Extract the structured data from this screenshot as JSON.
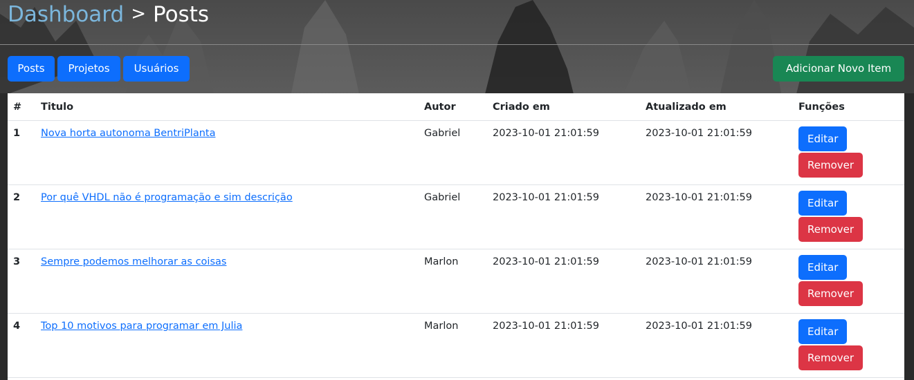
{
  "header": {
    "breadcrumb_root": "Dashboard",
    "breadcrumb_separator": ">",
    "breadcrumb_current": "Posts"
  },
  "nav": {
    "posts": "Posts",
    "projetos": "Projetos",
    "usuarios": "Usuários"
  },
  "actions": {
    "add_new": "Adicionar Novo Item"
  },
  "table": {
    "columns": [
      "#",
      "Titulo",
      "Autor",
      "Criado em",
      "Atualizado em",
      "Funções"
    ],
    "rows": [
      {
        "id": "1",
        "title": "Nova horta autonoma BentriPlanta",
        "author": "Gabriel",
        "created": "2023-10-01 21:01:59",
        "updated": "2023-10-01 21:01:59"
      },
      {
        "id": "2",
        "title": "Por quê VHDL não é programação e sim descrição",
        "author": "Gabriel",
        "created": "2023-10-01 21:01:59",
        "updated": "2023-10-01 21:01:59"
      },
      {
        "id": "3",
        "title": "Sempre podemos melhorar as coisas",
        "author": "Marlon",
        "created": "2023-10-01 21:01:59",
        "updated": "2023-10-01 21:01:59"
      },
      {
        "id": "4",
        "title": "Top 10 motivos para programar em Julia",
        "author": "Marlon",
        "created": "2023-10-01 21:01:59",
        "updated": "2023-10-01 21:01:59"
      }
    ],
    "edit_label": "Editar",
    "remove_label": "Remover"
  },
  "colors": {
    "primary": "#0d6efd",
    "success": "#198754",
    "danger": "#dc3545",
    "breadcrumb_root": "#7bb6dc"
  }
}
